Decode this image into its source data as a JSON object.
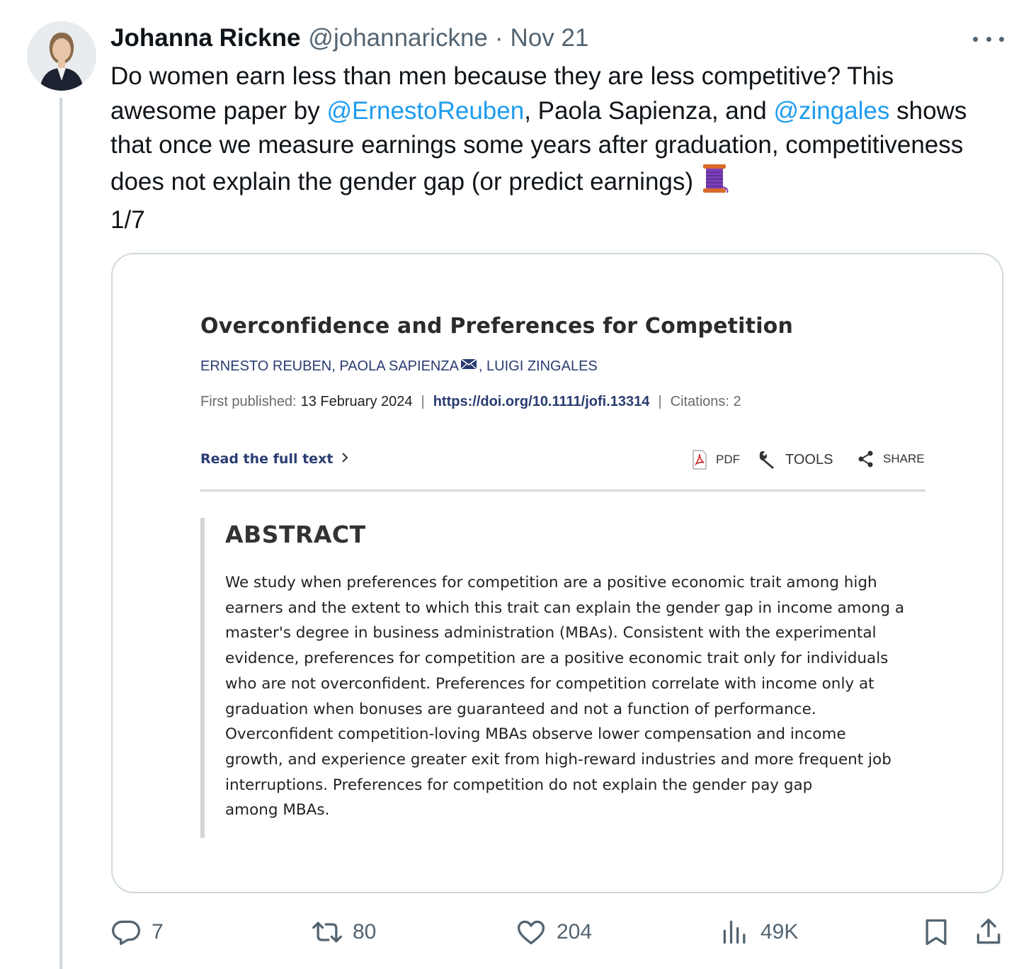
{
  "tweet": {
    "author_name": "Johanna Rickne",
    "handle": "@johannarickne",
    "separator": "·",
    "date": "Nov 21",
    "text_parts": {
      "p1": "Do women earn less than men because they are less competitive? This awesome paper by ",
      "mention1": "@ErnestoReuben",
      "p2": ", Paola Sapienza, and ",
      "mention2": "@zingales",
      "p3": " shows that once we measure earnings some years after graduation, competitiveness does not explain the gender gap (or predict earnings)",
      "p4": "1/7"
    },
    "thread_emoji": "thread-spool-icon"
  },
  "paper_card": {
    "title": "Overconfidence and Preferences for Competition",
    "authors_part1": "ERNESTO REUBEN, PAOLA SAPIENZA",
    "authors_part2": ", LUIGI ZINGALES",
    "first_published_label": "First published:",
    "first_published_date": "13 February 2024",
    "pipe": "|",
    "doi": "https://doi.org/10.1111/jofi.13314",
    "citations": "Citations: 2",
    "read_full_text": "Read the full text",
    "pdf_label": "PDF",
    "tools_label": "TOOLS",
    "share_label": "SHARE",
    "abstract_heading": "ABSTRACT",
    "abstract_lines": [
      "We study when preferences for competition are a positive economic trait among high",
      "earners and the extent to which this trait can explain the gender gap in income among a",
      "master's degree in business administration (MBAs). Consistent with the experimental",
      "evidence, preferences for competition are a positive economic trait only for individuals",
      "who are not overconfident. Preferences for competition correlate with income only at",
      "graduation when bonuses are guaranteed and not a function of performance.",
      "Overconfident competition-loving MBAs observe lower compensation and income",
      "growth, and experience greater exit from high-reward industries and more frequent job",
      "interruptions. Preferences for competition do not explain the gender pay gap",
      "among MBAs."
    ]
  },
  "actions": {
    "replies": "7",
    "retweets": "80",
    "likes": "204",
    "views": "49K"
  },
  "colors": {
    "text": "#0f1419",
    "secondary": "#536471",
    "link": "#1d9bf0",
    "card_border": "#cfd9de",
    "paper_link": "#2a3c71"
  }
}
